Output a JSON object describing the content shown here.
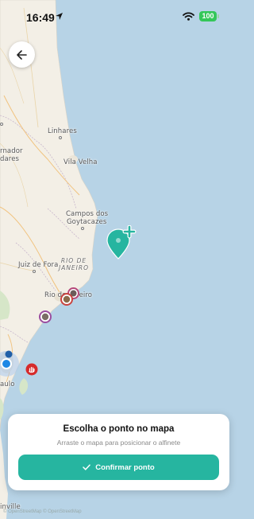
{
  "status_bar": {
    "time": "16:49",
    "battery": "100",
    "icons": [
      "location-arrow-icon",
      "wifi-icon",
      "battery-icon"
    ]
  },
  "back_button": {
    "icon": "arrow-left-icon"
  },
  "map": {
    "labels": {
      "linhares": "Linhares",
      "vila_velha": "Vila Velha",
      "campos_1": "Campos dos",
      "campos_2": "Goytacazes",
      "juiz_de_fora": "Juiz de Fora",
      "rio_de_janeiro_city": "Rio de Janeiro",
      "rio_state_1": "RIO DE",
      "rio_state_2": "JANEIRO",
      "paulo_partial": "aulo",
      "governador_partial_1": "rnador",
      "governador_partial_2": "dares",
      "inville_partial": "inville"
    },
    "center_pin_icon": "map-pin-add-icon",
    "user_location_icon": "user-location-icon"
  },
  "card": {
    "title": "Escolha o ponto no mapa",
    "subtitle": "Arraste o mapa para posicionar o alfinete",
    "confirm_label": "Confirmar ponto",
    "confirm_icon": "check-icon",
    "accent_color": "#26b5a0"
  },
  "attribution": "© OpenStreetMap © OpenStreetMap"
}
